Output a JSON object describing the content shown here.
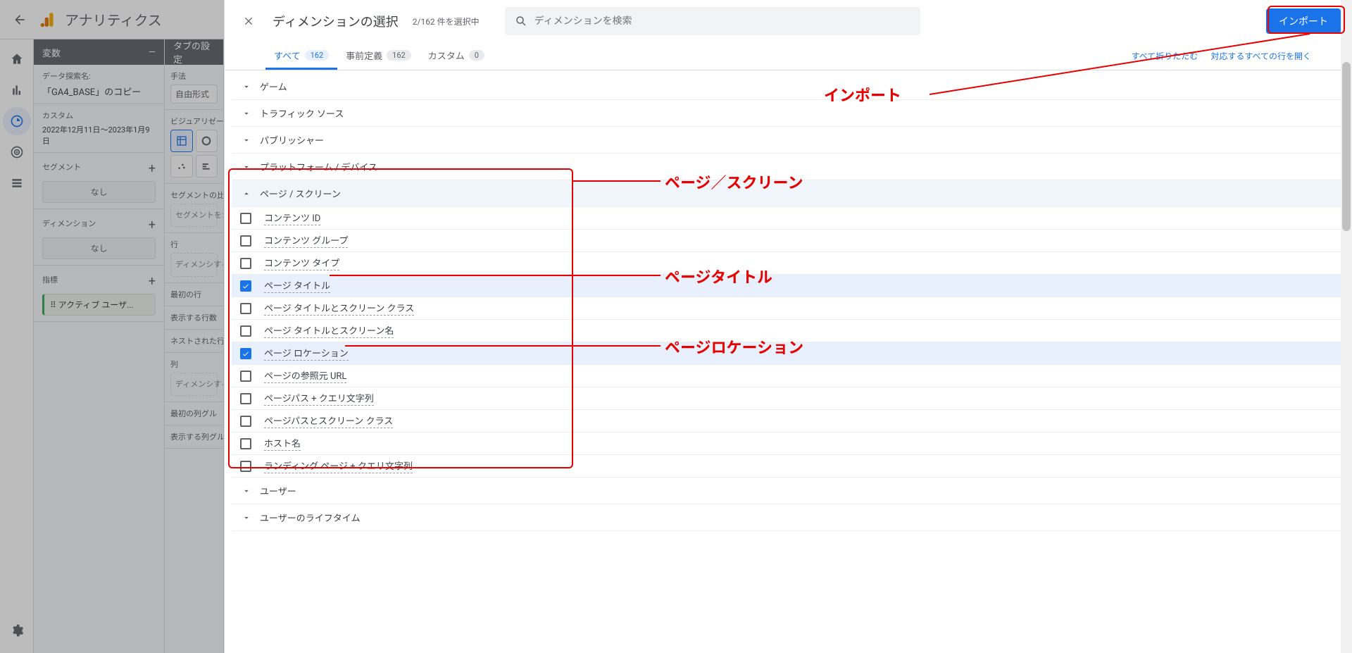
{
  "header": {
    "app_title": "アナリティクス"
  },
  "var_panel": {
    "title": "変数",
    "name_label": "データ探索名:",
    "name_value": "「GA4_BASE」のコピー",
    "custom_label": "カスタム",
    "date_range": "2022年12月11日～2023年1月9日",
    "segment_label": "セグメント",
    "none": "なし",
    "dimension_label": "ディメンション",
    "metric_label": "指標",
    "metric_chip": "⠿ アクティブ ユーザ..."
  },
  "tab_panel": {
    "title": "タブの設定",
    "technique_label": "手法",
    "technique_value": "自由形式",
    "viz_label": "ビジュアリゼー",
    "seg_compare_label": "セグメントの比",
    "seg_drop": "セグメントをか選択し",
    "rows_label": "行",
    "rows_drop": "ディメンシするか選択",
    "first_row_label": "最初の行",
    "show_rows_label": "表示する行数",
    "nested_label": "ネストされた行",
    "cols_label": "列",
    "cols_drop": "ディメンシするか選択",
    "first_col_label": "最初の列グル",
    "show_cols_label": "表示する列グル"
  },
  "modal": {
    "title": "ディメンションの選択",
    "count": "2/162 件を選択中",
    "search_placeholder": "ディメンションを検索",
    "import": "インポート",
    "collapse_all": "すべて折りたたむ",
    "expand_all": "対応するすべての行を開く",
    "tabs": {
      "all": {
        "label": "すべて",
        "count": "162"
      },
      "predef": {
        "label": "事前定義",
        "count": "162"
      },
      "custom": {
        "label": "カスタム",
        "count": "0"
      }
    },
    "groups_before": [
      "ゲーム",
      "トラフィック ソース",
      "パブリッシャー",
      "プラットフォーム / デバイス"
    ],
    "open_group": "ページ / スクリーン",
    "items": [
      {
        "label": "コンテンツ ID",
        "checked": false
      },
      {
        "label": "コンテンツ グループ",
        "checked": false
      },
      {
        "label": "コンテンツ タイプ",
        "checked": false
      },
      {
        "label": "ページ タイトル",
        "checked": true
      },
      {
        "label": "ページ タイトルとスクリーン クラス",
        "checked": false
      },
      {
        "label": "ページ タイトルとスクリーン名",
        "checked": false
      },
      {
        "label": "ページ ロケーション",
        "checked": true
      },
      {
        "label": "ページの参照元 URL",
        "checked": false
      },
      {
        "label": "ページパス + クエリ文字列",
        "checked": false
      },
      {
        "label": "ページパスとスクリーン クラス",
        "checked": false
      },
      {
        "label": "ホスト名",
        "checked": false
      },
      {
        "label": "ランディング ページ + クエリ文字列",
        "checked": false
      }
    ],
    "groups_after": [
      "ユーザー",
      "ユーザーのライフタイム"
    ]
  },
  "annotations": {
    "import": "インポート",
    "page_screen": "ページ／スクリーン",
    "page_title": "ページタイトル",
    "page_location": "ページロケーション"
  }
}
